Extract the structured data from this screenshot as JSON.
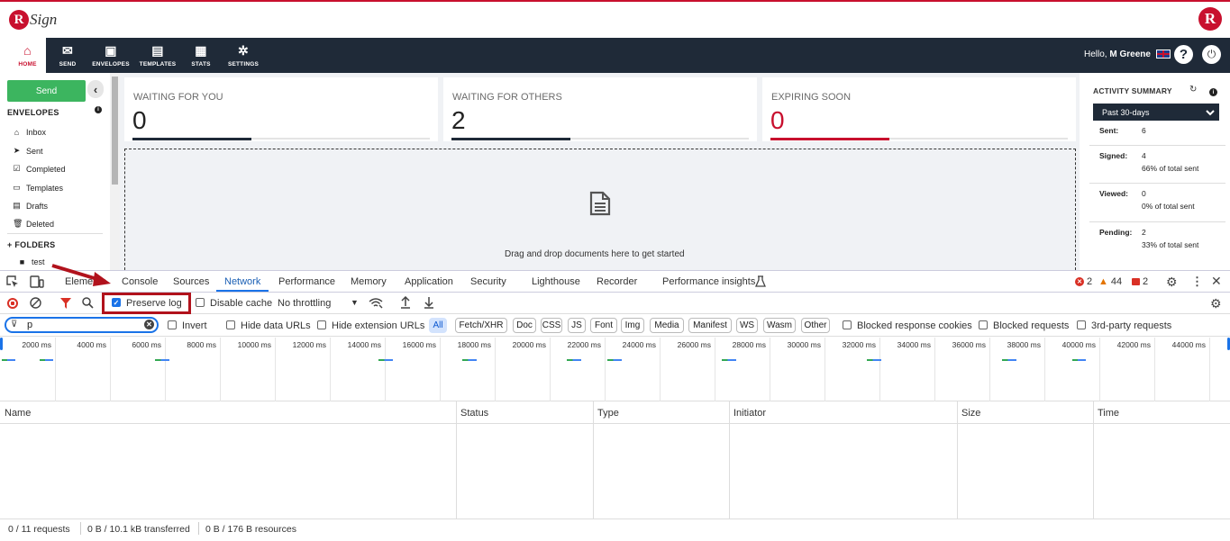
{
  "app": {
    "brand_letter": "R",
    "brand_text": "Sign",
    "brand_letter_right": "R"
  },
  "nav": {
    "items": [
      {
        "label": "HOME",
        "icon": "home-icon",
        "glyph": "⌂"
      },
      {
        "label": "SEND",
        "icon": "envelope-icon",
        "glyph": "✉"
      },
      {
        "label": "ENVELOPES",
        "icon": "inbox-icon",
        "glyph": "▣"
      },
      {
        "label": "TEMPLATES",
        "icon": "document-icon",
        "glyph": "▤"
      },
      {
        "label": "STATS",
        "icon": "briefcase-icon",
        "glyph": "▦"
      },
      {
        "label": "SETTINGS",
        "icon": "gear-icon",
        "glyph": "✲"
      }
    ],
    "greeting": "Hello,",
    "user": "M Greene",
    "help_glyph": "?",
    "power_glyph": "⏻"
  },
  "sidebar": {
    "send_label": "Send",
    "collapse_glyph": "‹",
    "envelopes_title": "ENVELOPES",
    "info_glyph": "i",
    "items": [
      {
        "label": "Inbox",
        "glyph": "⌂"
      },
      {
        "label": "Sent",
        "glyph": "➤"
      },
      {
        "label": "Completed",
        "glyph": "☑"
      },
      {
        "label": "Templates",
        "glyph": "▭"
      },
      {
        "label": "Drafts",
        "glyph": "▤"
      },
      {
        "label": "Deleted",
        "glyph": "🗑"
      }
    ],
    "folders_title": "+ FOLDERS",
    "folder": {
      "label": "test",
      "glyph": "■"
    }
  },
  "cards": [
    {
      "title": "WAITING FOR YOU",
      "value": "0",
      "color": "#1f2a38",
      "fill": 0.4
    },
    {
      "title": "WAITING FOR OTHERS",
      "value": "2",
      "color": "#1f2a38",
      "fill": 0.4
    },
    {
      "title": "EXPIRING SOON",
      "value": "0",
      "color": "#c8102e",
      "fill": 0.4
    }
  ],
  "dropzone": {
    "text": "Drag and drop documents here to get started"
  },
  "activity": {
    "title": "ACTIVITY SUMMARY",
    "refresh_glyph": "↻",
    "info_glyph": "i",
    "period": "Past 30-days",
    "rows": [
      {
        "key": "Sent:",
        "value": "6",
        "sub": ""
      },
      {
        "key": "Signed:",
        "value": "4",
        "sub": "66% of total sent"
      },
      {
        "key": "Viewed:",
        "value": "0",
        "sub": "0% of total sent"
      },
      {
        "key": "Pending:",
        "value": "2",
        "sub": "33% of total sent"
      }
    ]
  },
  "devtools": {
    "tabs": [
      "Elements",
      "Console",
      "Sources",
      "Network",
      "Performance",
      "Memory",
      "Application",
      "Security",
      "Lighthouse",
      "Recorder",
      "Performance insights"
    ],
    "active_tab": "Network",
    "errors": "2",
    "warnings": "44",
    "issues": "2",
    "toolbar": {
      "preserve_log": "Preserve log",
      "disable_cache": "Disable cache",
      "throttling": "No throttling"
    },
    "filter": {
      "value": "p",
      "invert": "Invert",
      "hide_data_urls": "Hide data URLs",
      "hide_extension_urls": "Hide extension URLs",
      "chips": [
        "All",
        "Fetch/XHR",
        "Doc",
        "CSS",
        "JS",
        "Font",
        "Img",
        "Media",
        "Manifest",
        "WS",
        "Wasm",
        "Other"
      ],
      "blocked_cookies": "Blocked response cookies",
      "blocked_requests": "Blocked requests",
      "third_party": "3rd-party requests"
    },
    "timeline_ticks": [
      "2000 ms",
      "4000 ms",
      "6000 ms",
      "8000 ms",
      "10000 ms",
      "12000 ms",
      "14000 ms",
      "16000 ms",
      "18000 ms",
      "20000 ms",
      "22000 ms",
      "24000 ms",
      "26000 ms",
      "28000 ms",
      "30000 ms",
      "32000 ms",
      "34000 ms",
      "36000 ms",
      "38000 ms",
      "40000 ms",
      "42000 ms",
      "44000 ms"
    ],
    "columns": [
      "Name",
      "Status",
      "Type",
      "Initiator",
      "Size",
      "Time"
    ],
    "status": {
      "requests": "0 / 11 requests",
      "transferred": "0 B / 10.1 kB transferred",
      "resources": "0 B / 176 B resources"
    }
  }
}
